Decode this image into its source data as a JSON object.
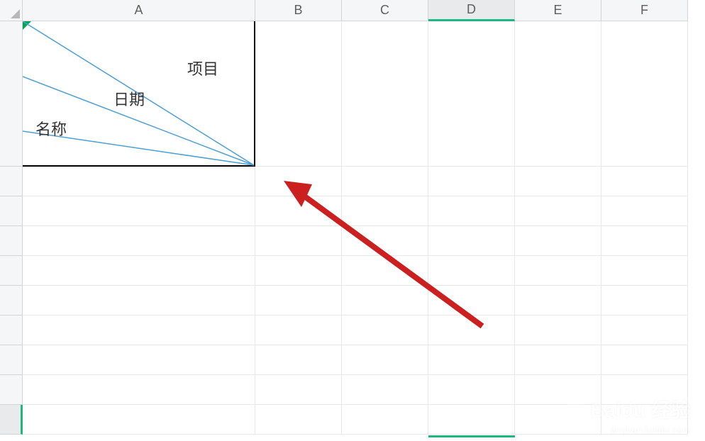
{
  "columns": [
    "A",
    "B",
    "C",
    "D",
    "E",
    "F"
  ],
  "selected_column": "D",
  "row_count_visible": 10,
  "cell_a1": {
    "labels": {
      "top_right": "项目",
      "middle": "日期",
      "bottom_left": "名称"
    }
  },
  "watermark": {
    "main": "Baidu 经验",
    "sub": "jingyan.baidu.com"
  },
  "colors": {
    "grid_line": "#e8e8e8",
    "header_border": "#d4d4d4",
    "header_bg": "#f5f6f7",
    "selection_green": "#1fb67f",
    "diagonal_line": "#4a9fd4",
    "arrow_red": "#cc1f1f",
    "indicator_green": "#00a651"
  }
}
